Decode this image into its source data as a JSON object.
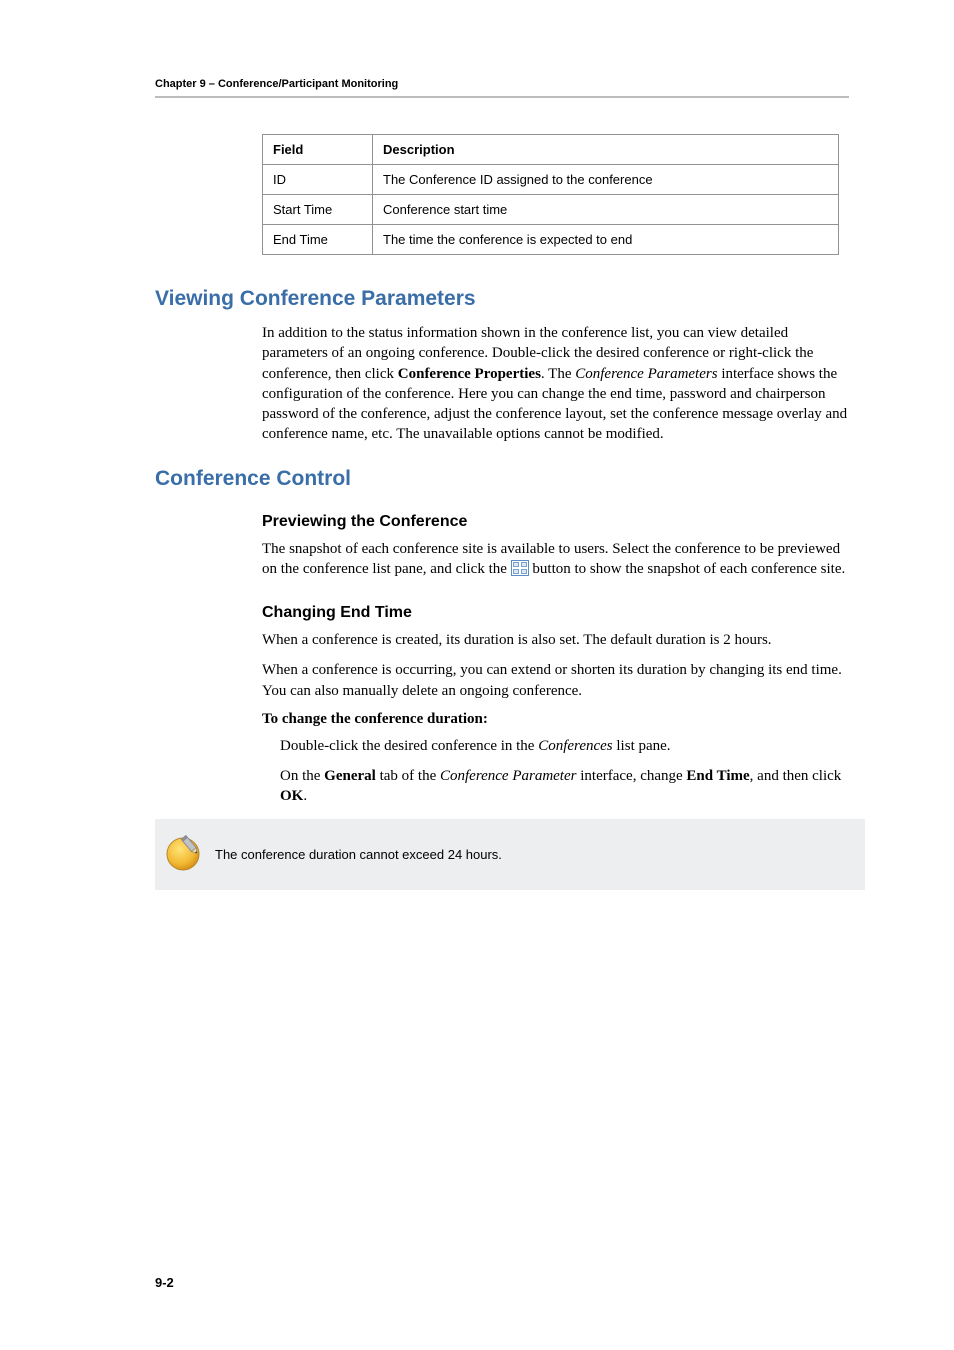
{
  "header": {
    "running": "Chapter 9 – Conference/Participant Monitoring"
  },
  "table": {
    "head_field": "Field",
    "head_desc": "Description",
    "rows": [
      {
        "field": "ID",
        "desc": "The Conference ID assigned to the conference"
      },
      {
        "field": "Start Time",
        "desc": "Conference start time"
      },
      {
        "field": "End Time",
        "desc": "The time the conference is expected to end"
      }
    ]
  },
  "sections": {
    "viewing": {
      "title": "Viewing Conference Parameters",
      "para1_a": "In addition to the status information shown in the conference list, you can view detailed parameters of an ongoing conference. Double-click the desired conference or right-click the conference, then click ",
      "para1_bold1": "Conference Properties",
      "para1_b": ". The ",
      "para1_i1": "Conference Parameters",
      "para1_c": " interface shows the configuration of the conference. Here you can change the end time, password and chairperson password of the conference, adjust the conference layout, set the conference message overlay and conference name, etc. The unavailable options cannot be modified."
    },
    "control": {
      "title": "Conference Control",
      "preview": {
        "title": "Previewing the Conference",
        "para_a": "The snapshot of each conference site is available to users. Select the conference to be previewed on the conference list pane, and click the ",
        "para_b": " button to show the snapshot of each conference site."
      },
      "changing": {
        "title": "Changing End Time",
        "para1": "When a conference is created, its duration is also set. The default duration is 2 hours.",
        "para2": "When a conference is occurring, you can extend or shorten its duration by changing its end time. You can also manually delete an ongoing conference.",
        "instr_head": "To change the conference duration:",
        "step1_a": "Double-click the desired conference in the ",
        "step1_i": "Conferences",
        "step1_b": " list pane.",
        "step2_a": "On the ",
        "step2_b1": "General",
        "step2_b": " tab of the ",
        "step2_i": "Conference Parameter",
        "step2_c": " interface, change ",
        "step2_b2": "End Time",
        "step2_d": ", and then click ",
        "step2_b3": "OK",
        "step2_e": "."
      }
    }
  },
  "note": {
    "text": "The conference duration cannot exceed 24 hours."
  },
  "footer": {
    "page": "9-2"
  }
}
